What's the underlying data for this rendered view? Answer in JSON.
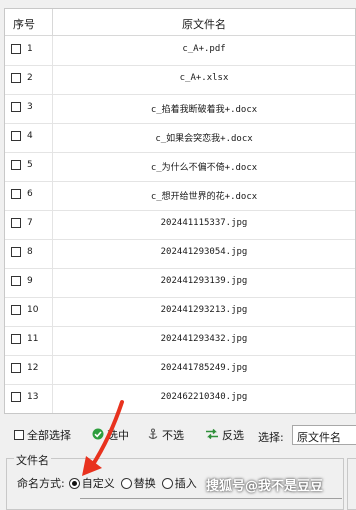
{
  "table": {
    "headers": {
      "index": "序号",
      "filename": "原文件名"
    },
    "rows": [
      {
        "index": "1",
        "filename": "c_A+.pdf"
      },
      {
        "index": "2",
        "filename": "c_A+.xlsx"
      },
      {
        "index": "3",
        "filename": "c_掐着我断破着我+.docx"
      },
      {
        "index": "4",
        "filename": "c_如果会突恋我+.docx"
      },
      {
        "index": "5",
        "filename": "c_为什么不偏不倚+.docx"
      },
      {
        "index": "6",
        "filename": "c_想开给世界的花+.docx"
      },
      {
        "index": "7",
        "filename": "202441115337.jpg"
      },
      {
        "index": "8",
        "filename": "202441293054.jpg"
      },
      {
        "index": "9",
        "filename": "202441293139.jpg"
      },
      {
        "index": "10",
        "filename": "202441293213.jpg"
      },
      {
        "index": "11",
        "filename": "202441293432.jpg"
      },
      {
        "index": "12",
        "filename": "202441785249.jpg"
      },
      {
        "index": "13",
        "filename": "202462210340.jpg"
      }
    ]
  },
  "toolbar": {
    "select_all": "全部选择",
    "select_mid": "选中",
    "no_select": "不选",
    "invert": "反选",
    "select_label": "选择:",
    "select_value": "原文件名"
  },
  "filename_group": {
    "title": "文件名",
    "mode_label": "命名方式:",
    "options": [
      "自定义",
      "替换",
      "插入"
    ],
    "selected": "自定义"
  },
  "watermark": "搜狐号@我不是豆豆",
  "colors": {
    "check_green": "#2e9e3e",
    "arrow_red": "#e8321e",
    "invert_green": "#2f8f3a"
  }
}
